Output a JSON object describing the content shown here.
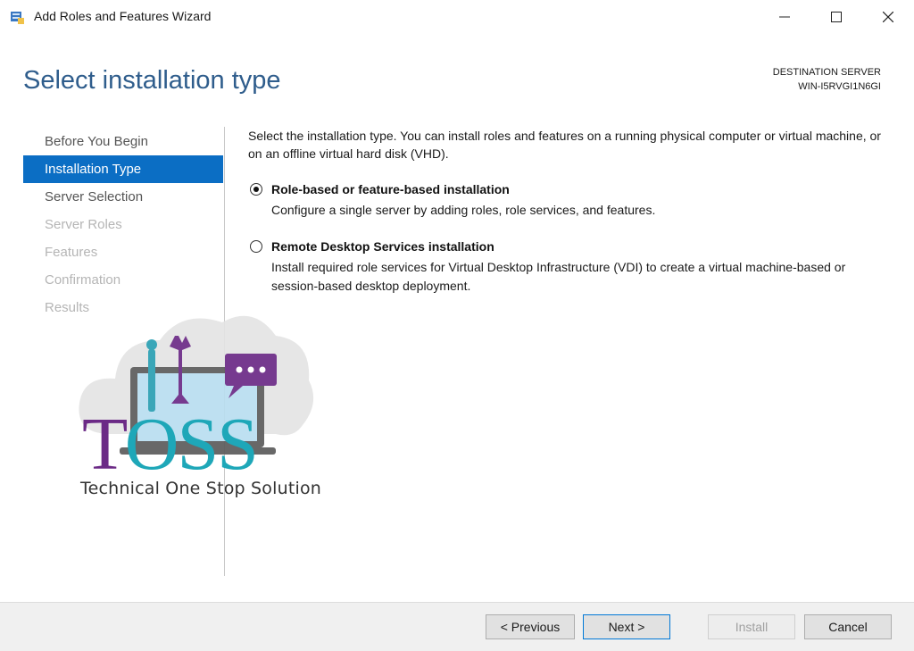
{
  "window": {
    "title": "Add Roles and Features Wizard",
    "controls": {
      "minimize": "minimize-icon",
      "maximize": "maximize-icon",
      "close": "close-icon"
    }
  },
  "header": {
    "page_title": "Select installation type",
    "destination_label": "DESTINATION SERVER",
    "destination_server": "WIN-I5RVGI1N6GI"
  },
  "nav": {
    "items": [
      {
        "label": "Before You Begin",
        "state": "normal"
      },
      {
        "label": "Installation Type",
        "state": "active"
      },
      {
        "label": "Server Selection",
        "state": "normal"
      },
      {
        "label": "Server Roles",
        "state": "disabled"
      },
      {
        "label": "Features",
        "state": "disabled"
      },
      {
        "label": "Confirmation",
        "state": "disabled"
      },
      {
        "label": "Results",
        "state": "disabled"
      }
    ]
  },
  "main": {
    "description": "Select the installation type. You can install roles and features on a running physical computer or virtual machine, or on an offline virtual hard disk (VHD).",
    "options": [
      {
        "title": "Role-based or feature-based installation",
        "description": "Configure a single server by adding roles, role services, and features.",
        "selected": true
      },
      {
        "title": "Remote Desktop Services installation",
        "description": "Install required role services for Virtual Desktop Infrastructure (VDI) to create a virtual machine-based or session-based desktop deployment.",
        "selected": false
      }
    ]
  },
  "footer": {
    "previous_label": "< Previous",
    "next_label": "Next >",
    "install_label": "Install",
    "cancel_label": "Cancel"
  },
  "watermark": {
    "logo_text_1": "T",
    "logo_text_2": "O",
    "logo_text_3": "SS",
    "tagline": "Technical One Stop Solution"
  },
  "colors": {
    "accent": "#0b6ec4",
    "title_blue": "#2f5d8c",
    "logo_purple": "#6b2a86",
    "logo_teal": "#1ea7b8"
  }
}
